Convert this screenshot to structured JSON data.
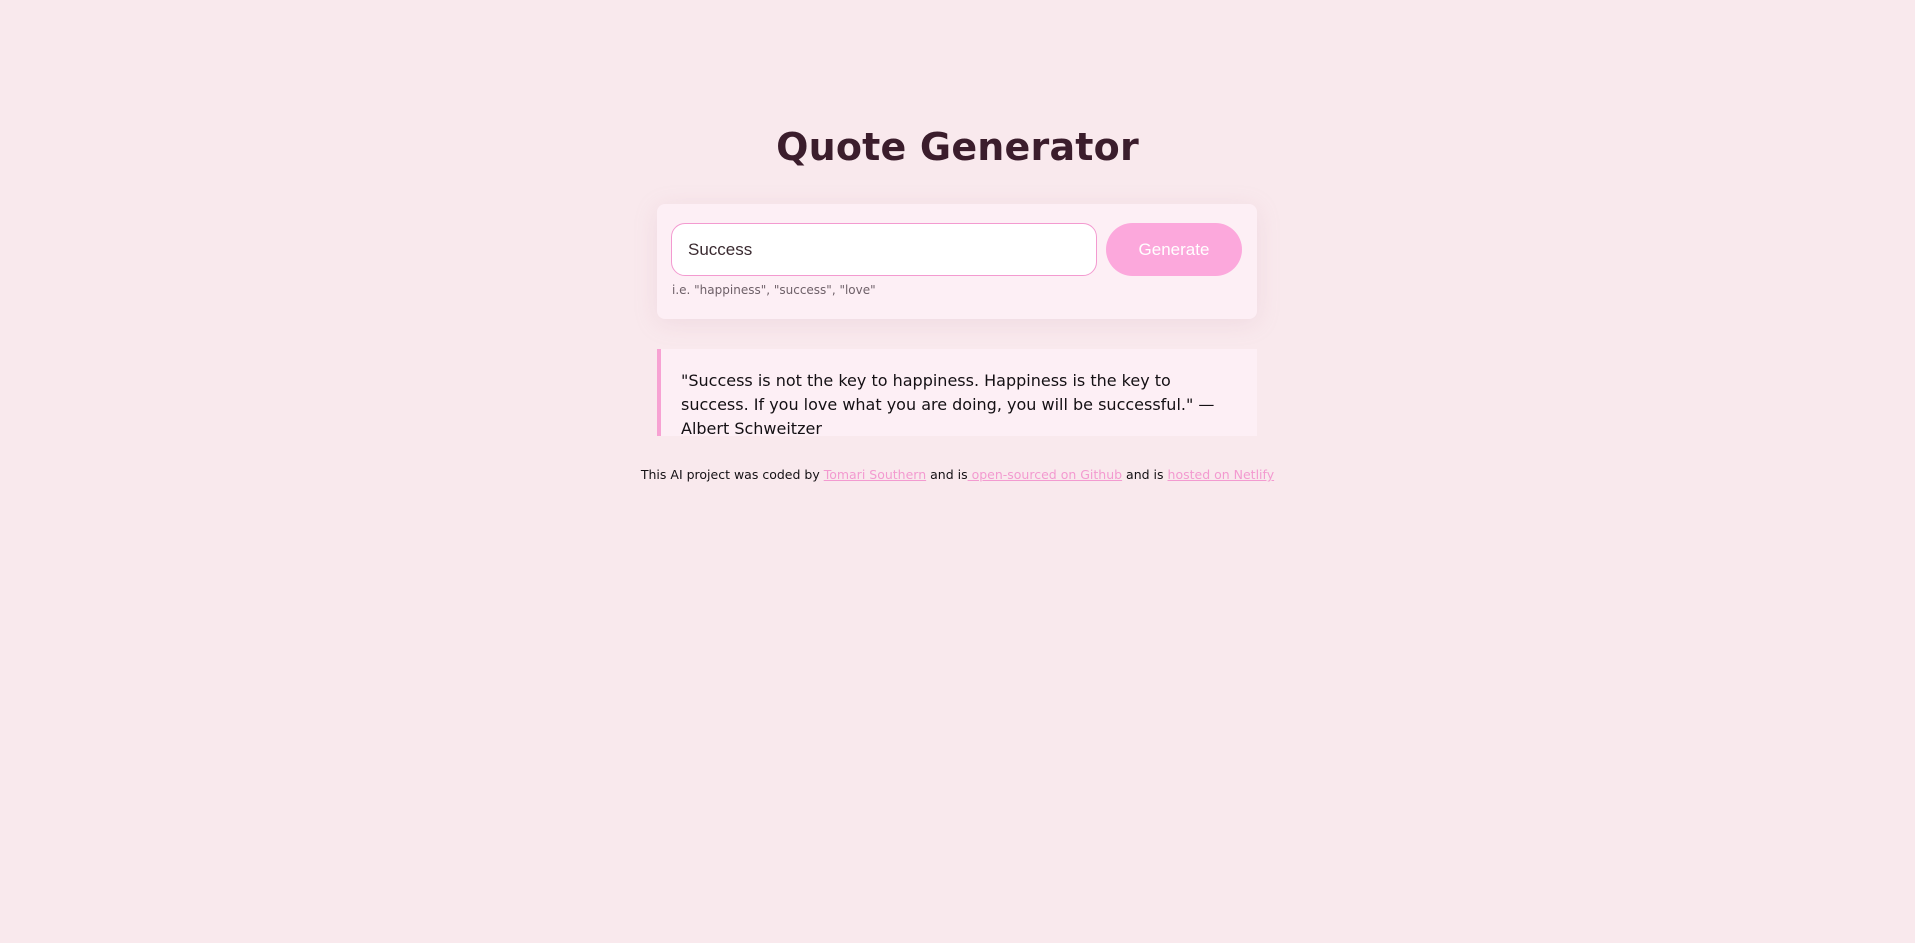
{
  "header": {
    "title": "Quote Generator"
  },
  "form": {
    "input_value": "Success",
    "generate_label": "Generate",
    "hint": "i.e. \"happiness\", \"success\", \"love\""
  },
  "quote": {
    "text": "\"Success is not the key to happiness. Happiness is the key to success. If you love what you are doing, you will be successful.\" — Albert Schweitzer"
  },
  "footer": {
    "prefix": "This AI project was coded by ",
    "author_link": "Tomari Southern",
    "middle1": " and is",
    "github_link": " open-sourced on Github",
    "middle2": " and is ",
    "netlify_link": "hosted on Netlify"
  },
  "colors": {
    "background": "#f9e9ed",
    "accent": "#fca8dc",
    "title": "#3b1d2c"
  }
}
